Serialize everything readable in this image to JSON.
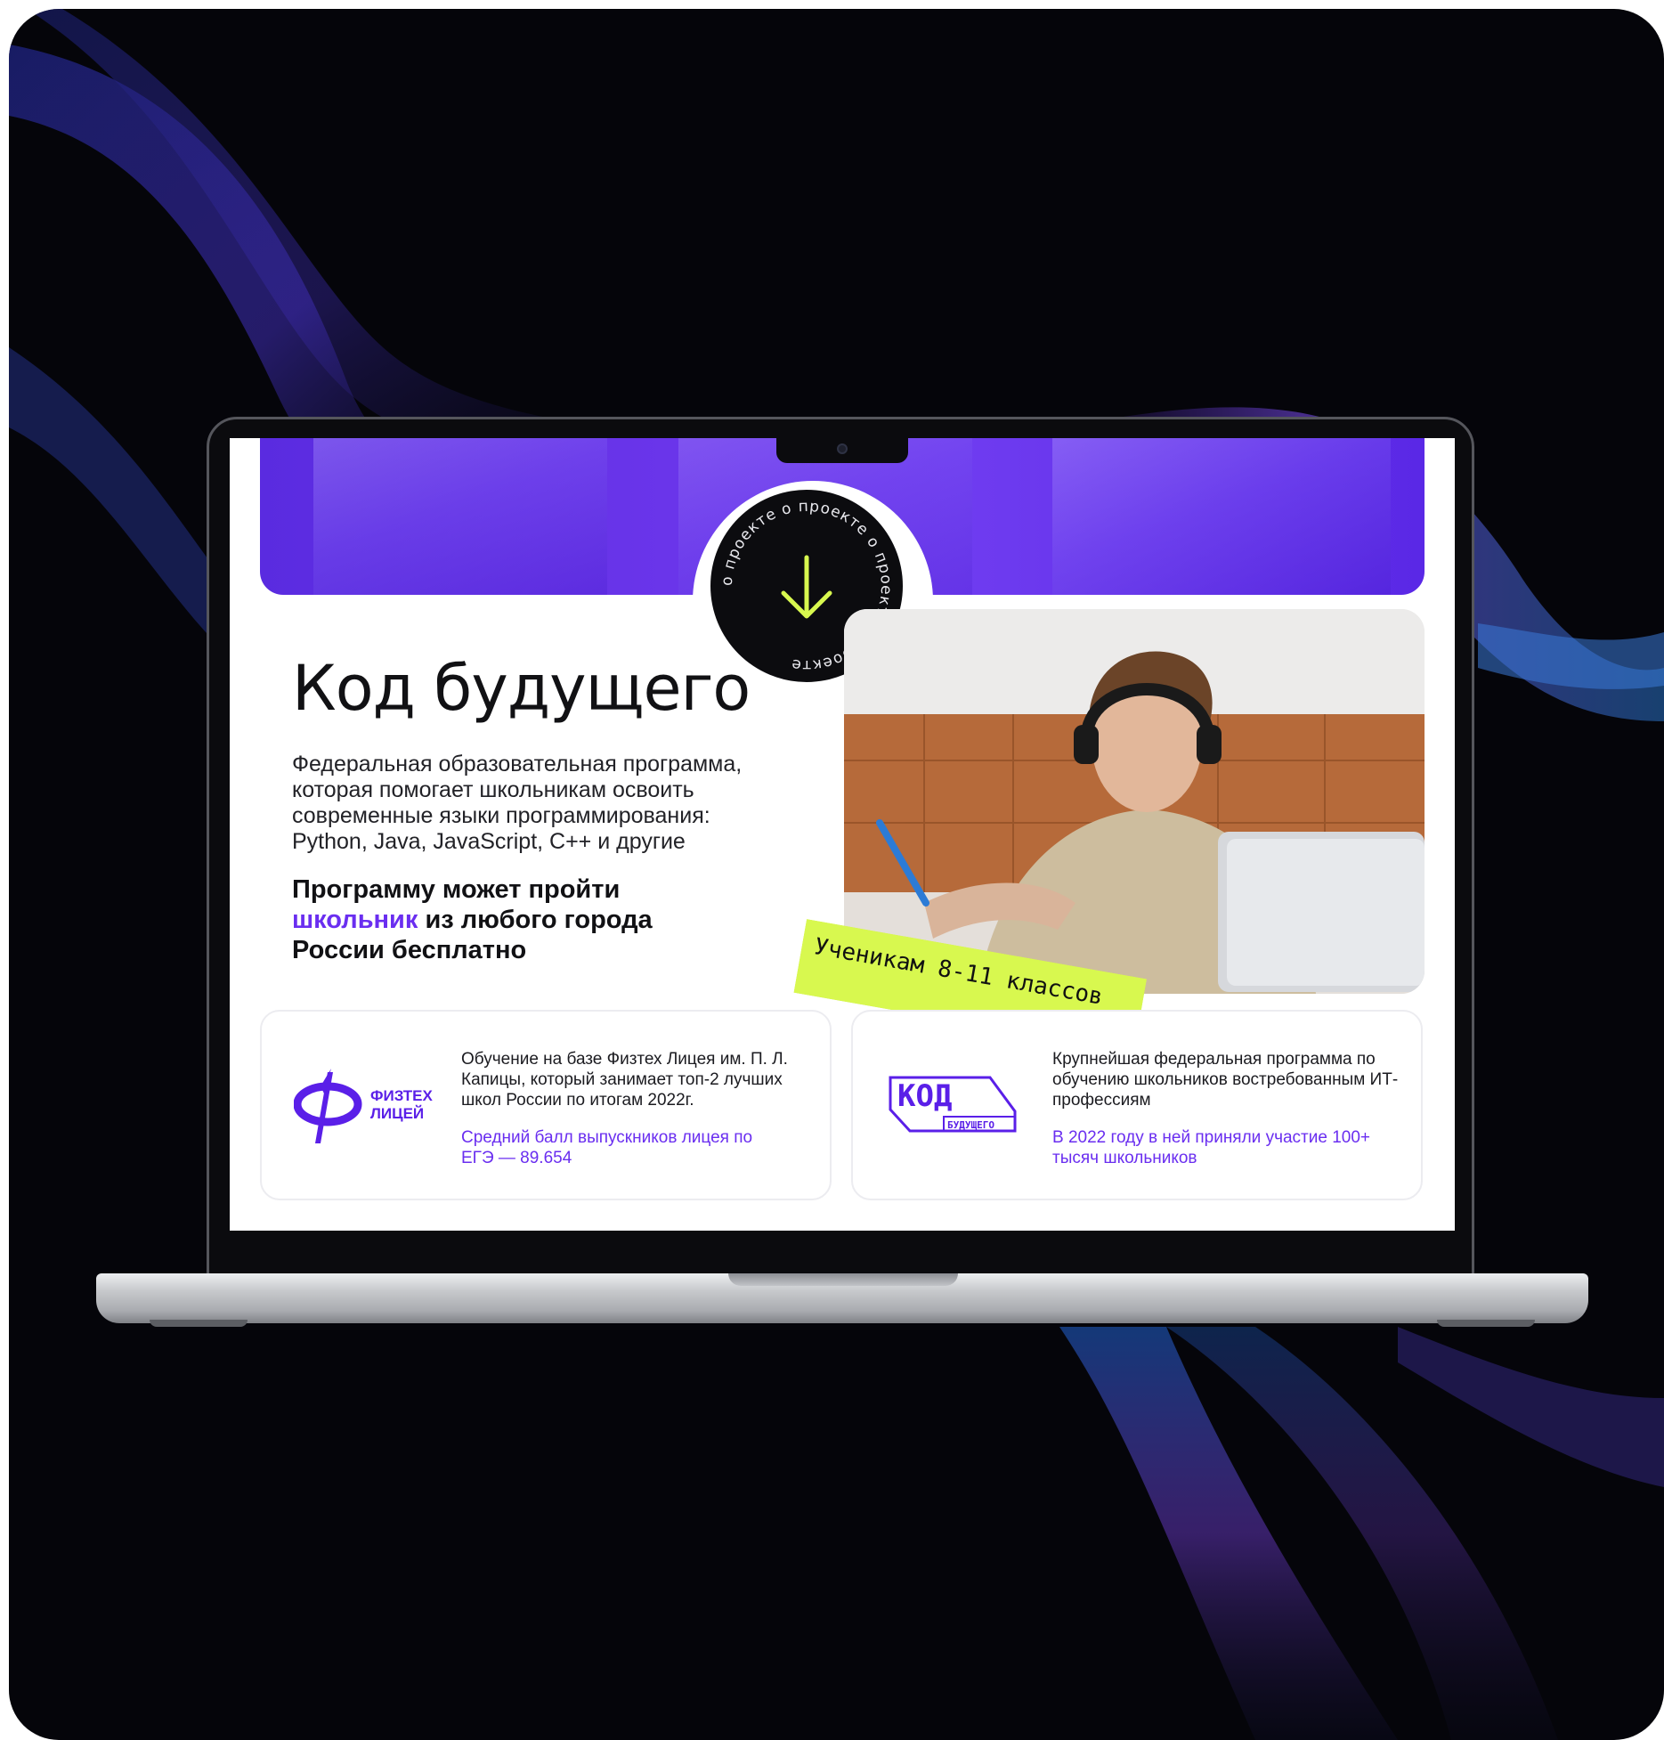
{
  "hero": {
    "badge_ring_text": "о проекте о проекте о проекте о проекте",
    "title": "Код будущего",
    "description": "Федеральная образовательная программа, которая помогает школьникам освоить современные языки программирования: Python, Java, JavaScript, C++ и другие",
    "tagline_start": "Программу может пройти ",
    "tagline_accent": "школьник",
    "tagline_end": " из любого города России бесплатно",
    "sticker": "Ученикам 8-11 классов",
    "sticker_arrow": "↖"
  },
  "cards": [
    {
      "logo_line1": "ФИЗТЕХ",
      "logo_line2": "ЛИЦЕЙ",
      "text": "Обучение на базе Физтех Лицея им. П. Л. Капицы, который занимает топ-2 лучших школ России по итогам 2022г.",
      "highlight": "Средний балл выпускников лицея по ЕГЭ — 89.654"
    },
    {
      "logo_line1": "КОД",
      "logo_line2": "БУДУЩЕГО",
      "text": "Крупнейшая федеральная программа по обучению школьников востребованным ИТ-профессиям",
      "highlight": "В 2022 году в ней приняли участие 100+ тысяч школьников"
    }
  ],
  "colors": {
    "accent": "#6a2ef0",
    "sticker": "#d8f84f",
    "badge": "#0c0c0f",
    "arrow": "#d8f84f"
  },
  "icons": {
    "badge_arrow": "arrow-down-icon",
    "fiztech_logo": "fiztech-lyceum-logo",
    "kod_logo": "kod-budushchego-logo"
  }
}
